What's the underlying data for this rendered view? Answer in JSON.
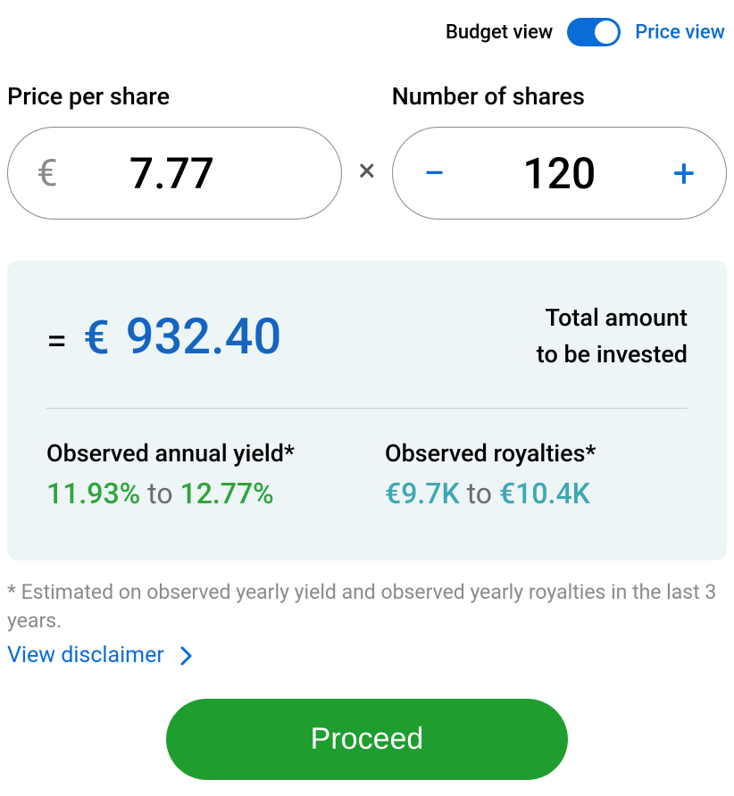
{
  "toggle": {
    "left_label": "Budget view",
    "right_label": "Price view",
    "state": "price"
  },
  "price_per_share": {
    "label": "Price per share",
    "currency": "€",
    "value": "7.77"
  },
  "shares": {
    "label": "Number of shares",
    "value": "120"
  },
  "multiply_symbol": "×",
  "total": {
    "equals": "=",
    "currency": "€",
    "value": "932.40",
    "label_line1": "Total amount",
    "label_line2": "to be invested"
  },
  "yield": {
    "label": "Observed annual yield*",
    "low": "11.93%",
    "to": "to",
    "high": "12.77%"
  },
  "royalties": {
    "label": "Observed royalties*",
    "low": "€9.7K",
    "to": "to",
    "high": "€10.4K"
  },
  "disclaimer_text": "* Estimated on observed yearly yield and observed yearly royalties in the last 3 years.",
  "disclaimer_link": "View disclaimer",
  "proceed": "Proceed"
}
